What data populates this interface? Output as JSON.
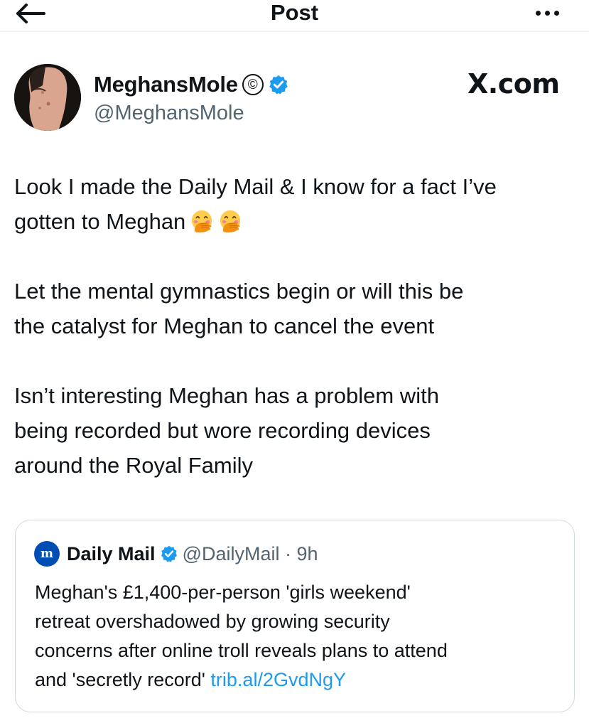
{
  "header": {
    "title": "Post",
    "back_icon": "arrow-left-icon",
    "more_icon": "more-horizontal-icon"
  },
  "author": {
    "display_name": "MeghansMole",
    "copyright_symbol": "©",
    "handle": "@MeghansMole",
    "verified_color": "#1d9bf0"
  },
  "watermark": "X.com",
  "post": {
    "paragraphs": [
      "Look I made the Daily Mail & I know for a fact I’ve\ngotten to Meghan",
      "Let the mental gymnastics begin or will this be\nthe catalyst for Meghan to cancel the event",
      "Isn’t interesting Meghan has a problem with\nbeing recorded but wore recording devices\naround the Royal Family"
    ],
    "emoji": [
      "face-with-hand-over-mouth-emoji",
      "face-with-hand-over-mouth-emoji"
    ]
  },
  "quote": {
    "logo_letter": "m",
    "name": "Daily Mail",
    "handle_time": "@DailyMail · 9h",
    "text": "Meghan's £1,400-per-person 'girls weekend'\nretreat overshadowed by growing security\nconcerns after online troll reveals plans to attend\nand 'secretly record' ",
    "link": "trib.al/2GvdNgY",
    "link_color": "#1d9bf0"
  }
}
